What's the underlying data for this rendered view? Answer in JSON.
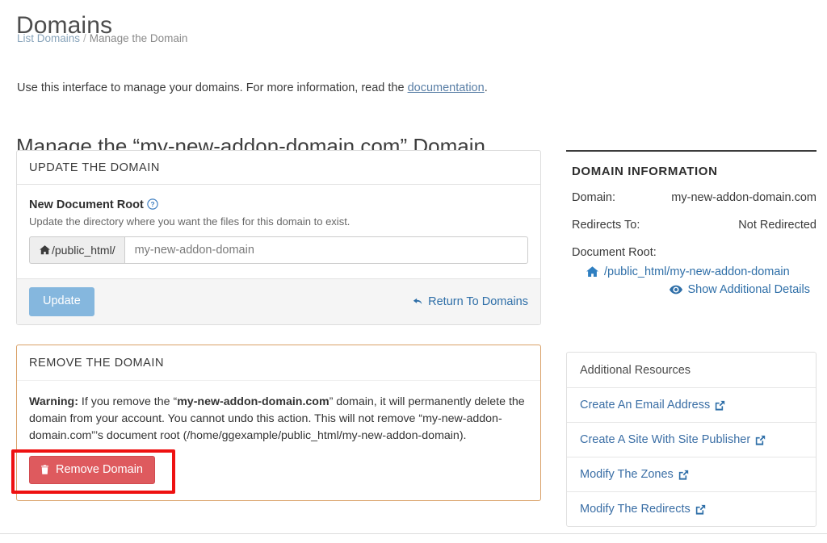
{
  "header": {
    "title": "Domains",
    "breadcrumb": {
      "link_label": "List Domains",
      "separator": "/",
      "current_label": "Manage the Domain"
    },
    "intro_before": "Use this interface to manage your domains. For more information, read the ",
    "intro_link": "documentation",
    "intro_after": ".",
    "section_heading": "Manage the “my-new-addon-domain.com” Domain"
  },
  "update_panel": {
    "heading": "UPDATE THE DOMAIN",
    "field_label": "New Document Root",
    "help_icon": "question-circle-icon",
    "field_help": "Update the directory where you want the files for this domain to exist.",
    "input_addon_icon": "home-icon",
    "input_addon_text": "/public_html/",
    "input_value": "my-new-addon-domain",
    "input_placeholder": "my-new-addon-domain",
    "update_button": "Update",
    "return_link": "Return To Domains",
    "return_icon": "arrow-undo-icon"
  },
  "remove_panel": {
    "heading": "REMOVE THE DOMAIN",
    "warning_label": "Warning:",
    "warning_part1": " If you remove the “",
    "domain_bold": "my-new-addon-domain.com",
    "warning_part2": "” domain, it will permanently delete the domain from your account. You cannot undo this action. This will not remove “my-new-addon-domain.com”’s document root (/home/ggexample/public_html/my-new-addon-domain).",
    "remove_button": "Remove Domain",
    "remove_icon": "trash-icon"
  },
  "domain_info": {
    "title": "DOMAIN INFORMATION",
    "rows": [
      {
        "key": "Domain:",
        "value": "my-new-addon-domain.com"
      },
      {
        "key": "Redirects To:",
        "value": "Not Redirected"
      }
    ],
    "document_root_label": "Document Root:",
    "document_root_icon": "home-icon",
    "document_root_value": "/public_html/my-new-addon-domain",
    "details_icon": "eye-icon",
    "details_label": "Show Additional Details"
  },
  "resources": {
    "heading": "Additional Resources",
    "items": [
      {
        "label": "Create An Email Address",
        "icon": "external-link-icon"
      },
      {
        "label": "Create A Site With Site Publisher",
        "icon": "external-link-icon"
      },
      {
        "label": "Modify The Zones",
        "icon": "external-link-icon"
      },
      {
        "label": "Modify The Redirects",
        "icon": "external-link-icon"
      }
    ]
  },
  "annotation": {
    "type": "highlight-box",
    "color": "#ee1111",
    "targets": "remove-domain-button"
  },
  "colors": {
    "link": "#2f6fa8",
    "primary_button": "#85b7de",
    "danger_button": "#de5a5e",
    "danger_border": "#d9a066",
    "annotation": "#ee1111"
  }
}
